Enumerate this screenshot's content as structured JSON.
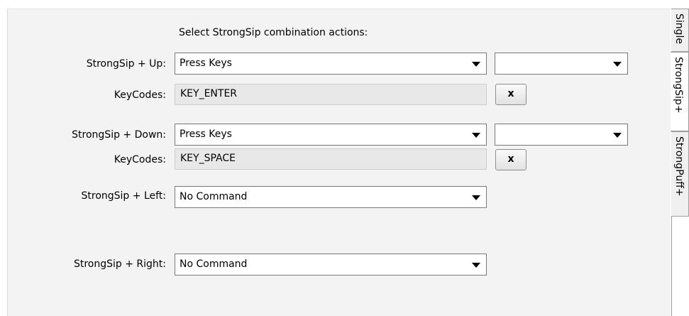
{
  "heading": "Select StrongSip combination actions:",
  "rows": {
    "up": {
      "label": "StrongSip + Up:",
      "action": "Press Keys",
      "secondary": "",
      "keycodes_label": "KeyCodes:",
      "keycodes": "KEY_ENTER",
      "clear_label": "x"
    },
    "down": {
      "label": "StrongSip + Down:",
      "action": "Press Keys",
      "secondary": "",
      "keycodes_label": "KeyCodes:",
      "keycodes": "KEY_SPACE",
      "clear_label": "x"
    },
    "left": {
      "label": "StrongSip + Left:",
      "action": "No Command"
    },
    "right": {
      "label": "StrongSip + Right:",
      "action": "No Command"
    }
  },
  "tabs": [
    "Single",
    "StrongSip+",
    "StrongPuff+"
  ],
  "active_tab": "StrongSip+",
  "icons": {
    "dropdown": "chevron-down-icon"
  }
}
